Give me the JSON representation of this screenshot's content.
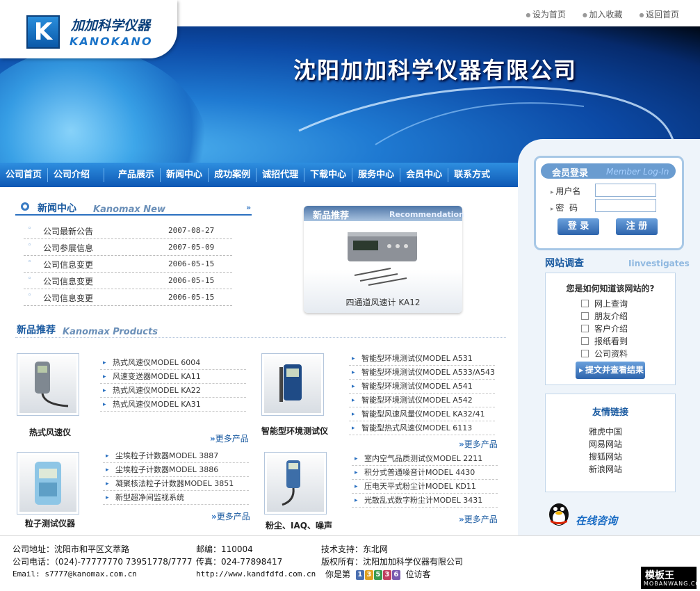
{
  "top_links": [
    "设为首页",
    "加入收藏",
    "返回首页"
  ],
  "logo": {
    "cn": "加加科学仪器",
    "en": "KANOKANO"
  },
  "banner": {
    "company": "沈阳加加科学仪器有限公司"
  },
  "nav": [
    "公司首页",
    "公司介绍",
    "产品展示",
    "新闻中心",
    "成功案例",
    "诚招代理",
    "下载中心",
    "服务中心",
    "会员中心",
    "联系方式"
  ],
  "login": {
    "title": "会员登录",
    "title_en": "Member Log-In",
    "username_label": "用户名",
    "password_label": "密  码",
    "login_button": "登 录",
    "register_button": "注 册"
  },
  "survey": {
    "title": "网站调查",
    "title_en": "Iinvestigates",
    "question": "您是如何知道该网站的?",
    "options": [
      "网上查询",
      "朋友介绍",
      "客户介绍",
      "报纸看到",
      "公司资料"
    ],
    "submit": "提文并查看结果"
  },
  "links": {
    "title": "友情链接",
    "items": [
      "雅虎中国",
      "网易网站",
      "搜狐网站",
      "新浪网站"
    ]
  },
  "consult": "在线咨询",
  "news": {
    "title": "新闻中心",
    "title_en": "Kanomax  New",
    "items": [
      {
        "title": "公司最新公告",
        "date": "2007-08-27"
      },
      {
        "title": "公司参展信息",
        "date": "2007-05-09"
      },
      {
        "title": "公司信息变更",
        "date": "2006-05-15"
      },
      {
        "title": "公司信息变更",
        "date": "2006-05-15"
      },
      {
        "title": "公司信息变更",
        "date": "2006-05-15"
      }
    ]
  },
  "recommend": {
    "title": "新品推荐",
    "title_en": "Recommendation",
    "caption": "四通道风速计 KA12"
  },
  "products": {
    "title": "新品推荐",
    "title_en": "Kanomax  Products",
    "more": "更多产品",
    "groups": [
      {
        "name": "热式风速仪",
        "items": [
          "热式风速仪MODEL 6004",
          "风速变送器MODEL KA11",
          "热式风速仪MODEL KA22",
          "热式风速仪MODEL KA31"
        ]
      },
      {
        "name": "智能型环境测试仪",
        "items": [
          "智能型环境测试仪MODEL A531",
          "智能型环境测试仪MODEL A533/A543",
          "智能型环境测试仪MODEL A541",
          "智能型环境测试仪MODEL A542",
          "智能型风速风量仪MODEL KA32/41",
          "智能型热式风速仪MODEL 6113"
        ]
      },
      {
        "name": "粒子测试仪器",
        "items": [
          "尘埃粒子计数器MODEL 3887",
          "尘埃粒子计数器MODEL 3886",
          "凝聚核法粒子计数器MODEL 3851",
          "新型超净间监视系统"
        ]
      },
      {
        "name": "粉尘、IAQ、噪声",
        "items": [
          "室内空气品质测试仪MODEL 2211",
          "积分式普通噪音计MODEL 4430",
          "压电天平式粉尘计MODEL KD11",
          "光散乱式数字粉尘计MODEL 3431"
        ]
      }
    ]
  },
  "footer": {
    "address": "公司地址：沈阳市和平区文萃路",
    "phone": "公司电话：（024)-77777770 73951778/7777",
    "email": "Email: s7777@kanomax.com.cn",
    "postcode": "邮编：110004",
    "fax": "传真：024-77898417",
    "url": "http://www.kandfdfd.com.cn",
    "support": "技术支持：东北网",
    "copyright": "版权所有：沈阳加加科学仪器有限公司",
    "visitor_prefix": "你是第",
    "visitor_digits": [
      "1",
      "3",
      "5",
      "3",
      "6"
    ],
    "visitor_suffix": "位访客"
  },
  "watermark": {
    "top": "模板王",
    "bottom": "MOBANWANG.COM"
  },
  "colors": {
    "primary": "#1a5aa0",
    "nav": "#0e58b4",
    "accent": "#2a70c0"
  }
}
